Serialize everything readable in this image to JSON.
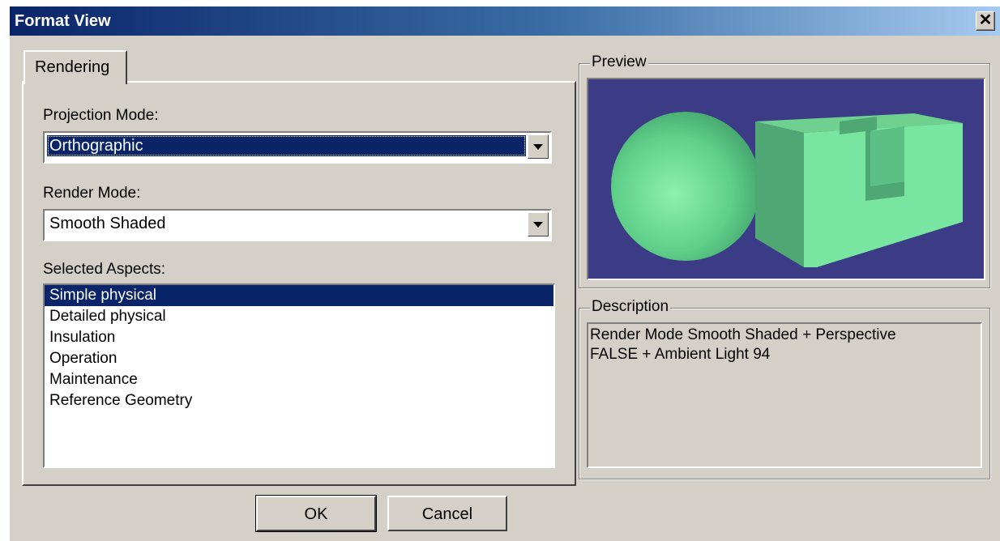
{
  "window": {
    "title": "Format View",
    "close_label": "✕"
  },
  "tabs": [
    {
      "label": "Rendering"
    }
  ],
  "rendering": {
    "projection_label": "Projection Mode:",
    "projection_value": "Orthographic",
    "render_label": "Render Mode:",
    "render_value": "Smooth Shaded",
    "aspects_label": "Selected Aspects:",
    "aspects": [
      "Simple physical",
      "Detailed physical",
      "Insulation",
      "Operation",
      "Maintenance",
      "Reference Geometry"
    ],
    "selected_aspect": "Simple physical"
  },
  "preview": {
    "label": "Preview",
    "background": "#3b3b86",
    "shape_color": "#6ed896"
  },
  "description": {
    "label": "Description",
    "line1": "Render Mode Smooth Shaded + Perspective",
    "line2": "FALSE + Ambient Light 94"
  },
  "buttons": {
    "ok": "OK",
    "cancel": "Cancel"
  }
}
